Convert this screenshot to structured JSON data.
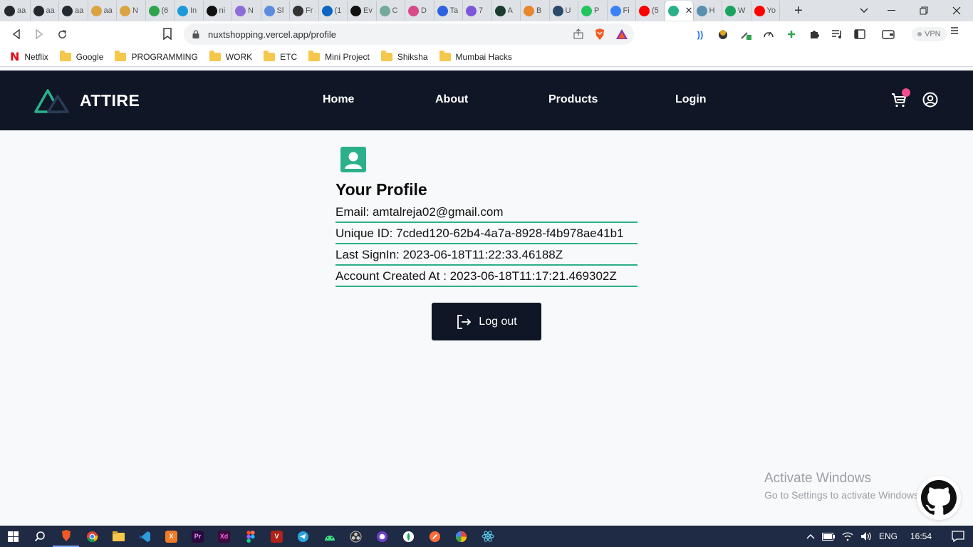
{
  "browser": {
    "tabs": [
      {
        "title": "aa",
        "icon": "github-icon",
        "color": "#24292f"
      },
      {
        "title": "aa",
        "icon": "github-icon",
        "color": "#24292f"
      },
      {
        "title": "aa",
        "icon": "github-icon",
        "color": "#24292f"
      },
      {
        "title": "aa",
        "icon": "edge-icon",
        "color": "#d9a441"
      },
      {
        "title": "N",
        "icon": "edge-icon",
        "color": "#d9a441"
      },
      {
        "title": "(6",
        "icon": "badge-icon",
        "color": "#2ea44f"
      },
      {
        "title": "In",
        "icon": "is-icon",
        "color": "#1a9ad6"
      },
      {
        "title": "ni",
        "icon": "nuxt-icon",
        "color": "#111111"
      },
      {
        "title": "N",
        "icon": "messenger-icon",
        "color": "#8e6cd9"
      },
      {
        "title": "Sl",
        "icon": "reddit-icon",
        "color": "#5b8cde"
      },
      {
        "title": "Fr",
        "icon": "alien-icon",
        "color": "#333333"
      },
      {
        "title": "(1",
        "icon": "linkedin-icon",
        "color": "#0a66c2"
      },
      {
        "title": "Ev",
        "icon": "star-icon",
        "color": "#111111"
      },
      {
        "title": "C",
        "icon": "chatgpt-icon",
        "color": "#74aa9c"
      },
      {
        "title": "D",
        "icon": "link-icon",
        "color": "#d64a8a"
      },
      {
        "title": "Ta",
        "icon": "play-icon",
        "color": "#2b63e0"
      },
      {
        "title": "7",
        "icon": "ui-icon",
        "color": "#7f56d9"
      },
      {
        "title": "A",
        "icon": "chart-icon",
        "color": "#1b3b2e"
      },
      {
        "title": "B",
        "icon": "flame-icon",
        "color": "#e8872b"
      },
      {
        "title": "U",
        "icon": "tds-icon",
        "color": "#2b4a6a"
      },
      {
        "title": "P",
        "icon": "rk-icon",
        "color": "#22c55e"
      },
      {
        "title": "Fi",
        "icon": "k-icon",
        "color": "#3b82f6"
      },
      {
        "title": "(5",
        "icon": "youtube-icon",
        "color": "#ff0000"
      },
      {
        "title": "",
        "icon": "nuxt-icon",
        "color": "#2bb08a",
        "active": true
      },
      {
        "title": "H",
        "icon": "box-icon",
        "color": "#5a8fb0"
      },
      {
        "title": "W",
        "icon": "w-icon",
        "color": "#1aa260"
      },
      {
        "title": "Yo",
        "icon": "youtube-music-icon",
        "color": "#ff0000"
      }
    ],
    "url": "nuxtshopping.vercel.app/profile",
    "vpn_label": "VPN",
    "bookmarks": [
      {
        "label": "Netflix",
        "type": "netflix"
      },
      {
        "label": "Google",
        "type": "folder"
      },
      {
        "label": "PROGRAMMING",
        "type": "folder"
      },
      {
        "label": "WORK",
        "type": "folder"
      },
      {
        "label": "ETC",
        "type": "folder"
      },
      {
        "label": "Mini Project",
        "type": "folder"
      },
      {
        "label": "Shiksha",
        "type": "folder"
      },
      {
        "label": "Mumbai Hacks",
        "type": "folder"
      }
    ]
  },
  "site": {
    "brand": "ATTIRE",
    "nav": {
      "home": "Home",
      "about": "About",
      "products": "Products",
      "login": "Login"
    },
    "accent": "#2bb08a",
    "header_bg": "#0f1625",
    "cart_badge_color": "#ef4f8a"
  },
  "profile": {
    "title": "Your Profile",
    "rows": [
      "Email: amtalreja02@gmail.com",
      "Unique ID: 7cded120-62b4-4a7a-8928-f4b978ae41b1",
      "Last SignIn: 2023-06-18T11:22:33.46188Z",
      "Account Created At : 2023-06-18T11:17:21.469302Z"
    ],
    "logout_label": "Log out"
  },
  "watermark": {
    "line1": "Activate Windows",
    "line2": "Go to Settings to activate Windows."
  },
  "taskbar": {
    "language": "ENG",
    "time": "16:54"
  }
}
